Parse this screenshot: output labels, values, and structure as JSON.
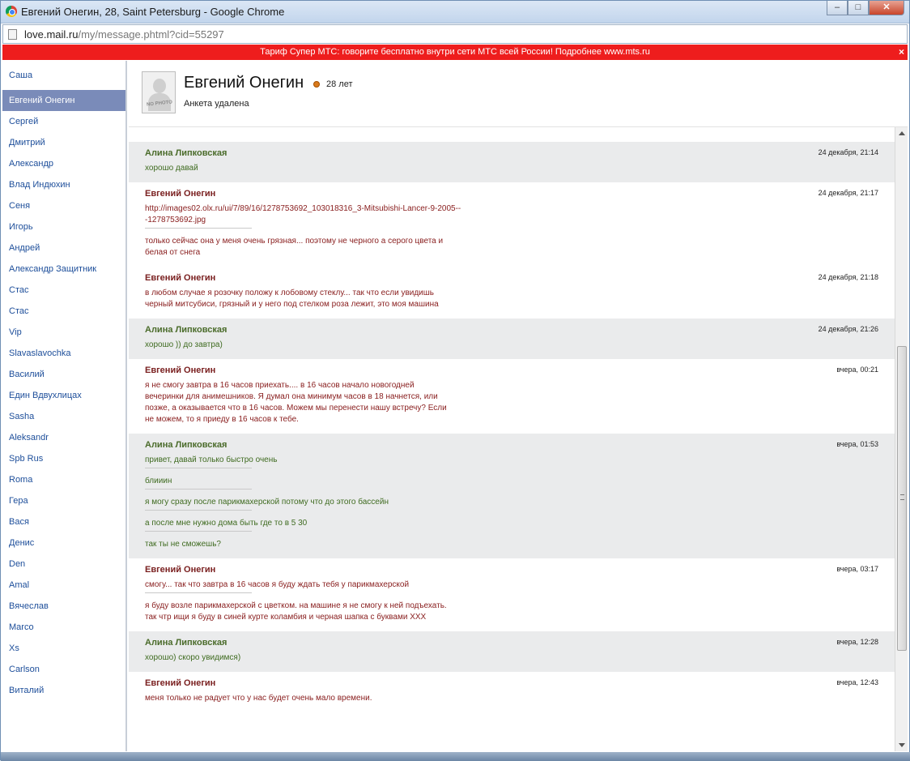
{
  "window": {
    "title": "Евгений Онегин, 28, Saint Petersburg - Google Chrome",
    "minimize": "–",
    "maximize": "□",
    "close": "✕"
  },
  "address": {
    "host": "love.mail.ru",
    "path": "/my/message.phtml?cid=55297"
  },
  "promo": {
    "text": "Тариф Супер МТС: говорите бесплатно внутри сети МТС всей России! Подробнее www.mts.ru",
    "close": "×"
  },
  "sidebar": {
    "items": [
      {
        "label": "Саша"
      },
      {
        "label": "Евгений Онегин"
      },
      {
        "label": "Сергей"
      },
      {
        "label": "Дмитрий"
      },
      {
        "label": "Александр"
      },
      {
        "label": "Влад Индюхин"
      },
      {
        "label": "Сеня"
      },
      {
        "label": "Игорь"
      },
      {
        "label": "Андрей"
      },
      {
        "label": "Александр Защитник"
      },
      {
        "label": "Стас"
      },
      {
        "label": "Стас"
      },
      {
        "label": "Vip"
      },
      {
        "label": "Slavaslavochka"
      },
      {
        "label": "Василий"
      },
      {
        "label": "Един Вдвухлицах"
      },
      {
        "label": "Sasha"
      },
      {
        "label": "Aleksandr"
      },
      {
        "label": "Spb Rus"
      },
      {
        "label": "Roma"
      },
      {
        "label": "Гера"
      },
      {
        "label": "Вася"
      },
      {
        "label": "Денис"
      },
      {
        "label": "Den"
      },
      {
        "label": "Amal"
      },
      {
        "label": "Вячеслав"
      },
      {
        "label": "Marco"
      },
      {
        "label": "Xs"
      },
      {
        "label": "Carlson"
      },
      {
        "label": "Виталий"
      }
    ]
  },
  "profile": {
    "name": "Евгений Онегин",
    "age": "28 лет",
    "status": "Анкета удалена",
    "avatar_text": "NO PHOTO"
  },
  "messages": [
    {
      "author": "Алина Липковская",
      "time": "24 декабря, 21:14",
      "who": "alina",
      "blocks": [
        [
          "хорошо давай"
        ]
      ]
    },
    {
      "author": "Евгений Онегин",
      "time": "24 декабря, 21:17",
      "who": "evg",
      "blocks": [
        [
          "http://images02.olx.ru/ui/7/89/16/1278753692_103018316_3-Mitsubishi-Lancer-9-2005--",
          "-1278753692.jpg"
        ],
        [
          "только сейчас она у меня очень грязная... поэтому не черного а серого цвета и",
          "белая от снега"
        ]
      ]
    },
    {
      "author": "Евгений Онегин",
      "time": "24 декабря, 21:18",
      "who": "evg",
      "blocks": [
        [
          "в любом случае я розочку положу к лобовому стеклу... так что если увидишь",
          "черный митсубиси, грязный и у него под стелком роза лежит, это моя машина"
        ]
      ]
    },
    {
      "author": "Алина Липковская",
      "time": "24 декабря, 21:26",
      "who": "alina",
      "blocks": [
        [
          "хорошо )) до завтра)"
        ]
      ]
    },
    {
      "author": "Евгений Онегин",
      "time": "вчера, 00:21",
      "who": "evg",
      "blocks": [
        [
          "я не смогу завтра в 16 часов приехать.... в 16 часов начало новогодней",
          "вечеринки для анимешников. Я думал она минимум часов в 18 начнется, или",
          "позже, а оказывается что в 16 часов. Можем мы перенести нашу встречу? Если",
          "не можем, то я приеду в 16 часов к тебе."
        ]
      ]
    },
    {
      "author": "Алина Липковская",
      "time": "вчера, 01:53",
      "who": "alina",
      "blocks": [
        [
          "привет, давай только быстро очень"
        ],
        [
          "блииин"
        ],
        [
          "я могу сразу после парикмахерской потому что до этого бассейн"
        ],
        [
          "а после мне нужно дома быть где то в 5 30"
        ],
        [
          "так ты не сможешь?"
        ]
      ]
    },
    {
      "author": "Евгений Онегин",
      "time": "вчера, 03:17",
      "who": "evg",
      "blocks": [
        [
          "смогу... так что завтра в 16 часов я буду ждать тебя у парикмахерской"
        ],
        [
          "я буду возле парикмахерской с цветком. на машине я не смогу к ней подъехать.",
          "так чтр ищи я буду в синей курте коламбия и черная шапка с буквами XXX"
        ]
      ]
    },
    {
      "author": "Алина Липковская",
      "time": "вчера, 12:28",
      "who": "alina",
      "blocks": [
        [
          "хорошо) скоро увидимся)"
        ]
      ]
    },
    {
      "author": "Евгений Онегин",
      "time": "вчера, 12:43",
      "who": "evg",
      "blocks": [
        [
          "меня только не радует что у нас будет очень мало времени."
        ]
      ]
    }
  ]
}
